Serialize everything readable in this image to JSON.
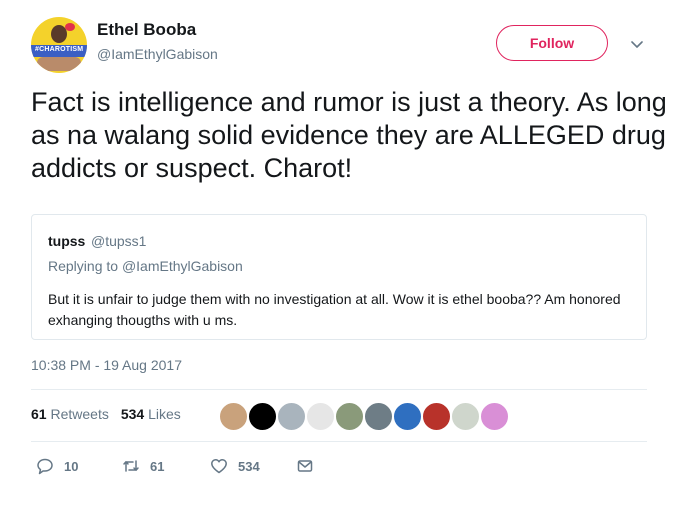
{
  "author": {
    "name": "Ethel Booba",
    "handle": "@IamEthylGabison",
    "avatar_badge_text": "#CHAROTISM"
  },
  "follow_label": "Follow",
  "tweet_text": "Fact is intelligence and rumor is just a theory. As long as na walang solid evidence they are ALLEGED drug addicts or suspect. Charot!",
  "quoted": {
    "name": "tupss",
    "handle": "@tupss1",
    "replying_prefix": "Replying to",
    "replying_to": "@IamEthylGabison",
    "text": "But it is unfair to judge them with no investigation at all. Wow it is ethel booba?? Am honored exhanging thougths with u ms."
  },
  "timestamp": "10:38 PM - 19 Aug 2017",
  "stats": {
    "retweets_count": "61",
    "retweets_label": "Retweets",
    "likes_count": "534",
    "likes_label": "Likes"
  },
  "likers": [
    {
      "icon": "user-avatar",
      "color": "#c9a27c"
    },
    {
      "icon": "user-avatar",
      "color": "#000000"
    },
    {
      "icon": "default-user-avatar",
      "color": "#a9b4bd"
    },
    {
      "icon": "meme-face-avatar",
      "color": "#e6e6e6"
    },
    {
      "icon": "user-avatar",
      "color": "#8a9a7a"
    },
    {
      "icon": "user-avatar",
      "color": "#6e7d86"
    },
    {
      "icon": "user-avatar",
      "color": "#2f6fc0"
    },
    {
      "icon": "user-avatar",
      "color": "#b8322a"
    },
    {
      "icon": "user-avatar",
      "color": "#cfd6cc"
    },
    {
      "icon": "user-avatar",
      "color": "#d98fd6"
    }
  ],
  "actions": {
    "reply_count": "10",
    "retweet_count": "61",
    "like_count": "534"
  },
  "colors": {
    "follow_accent": "#e0245e",
    "secondary_text": "#657786",
    "primary_text": "#14171a",
    "border": "#e1e8ed"
  }
}
